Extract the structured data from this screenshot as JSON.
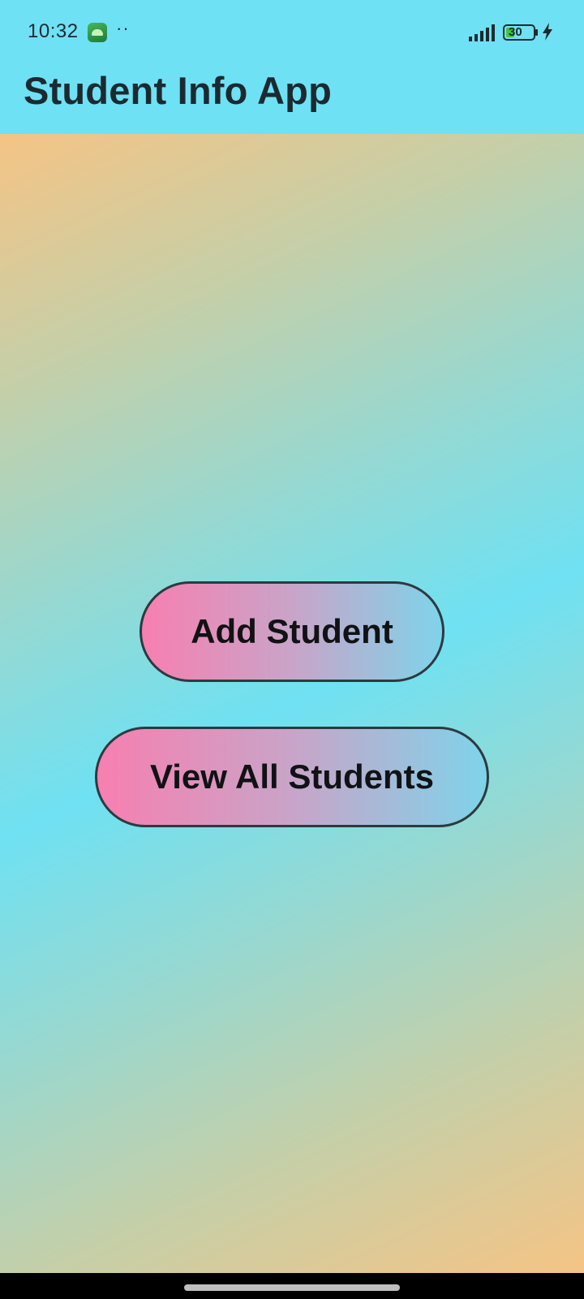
{
  "status_bar": {
    "time": "10:32",
    "more": "··",
    "battery_level": "30",
    "icons": [
      "app-notification-icon",
      "signal-icon",
      "battery-icon",
      "charging-icon"
    ]
  },
  "app_bar": {
    "title": "Student Info App",
    "background_color": "#6fe1f5"
  },
  "main": {
    "buttons": [
      {
        "label": "Add Student"
      },
      {
        "label": "View All Students"
      }
    ]
  },
  "colors": {
    "gradient_edge": "#f5c485",
    "gradient_center": "#6fe1f2",
    "button_start": "#f77fb0",
    "button_end": "#7fd3ea",
    "button_border": "#2c3a40"
  }
}
